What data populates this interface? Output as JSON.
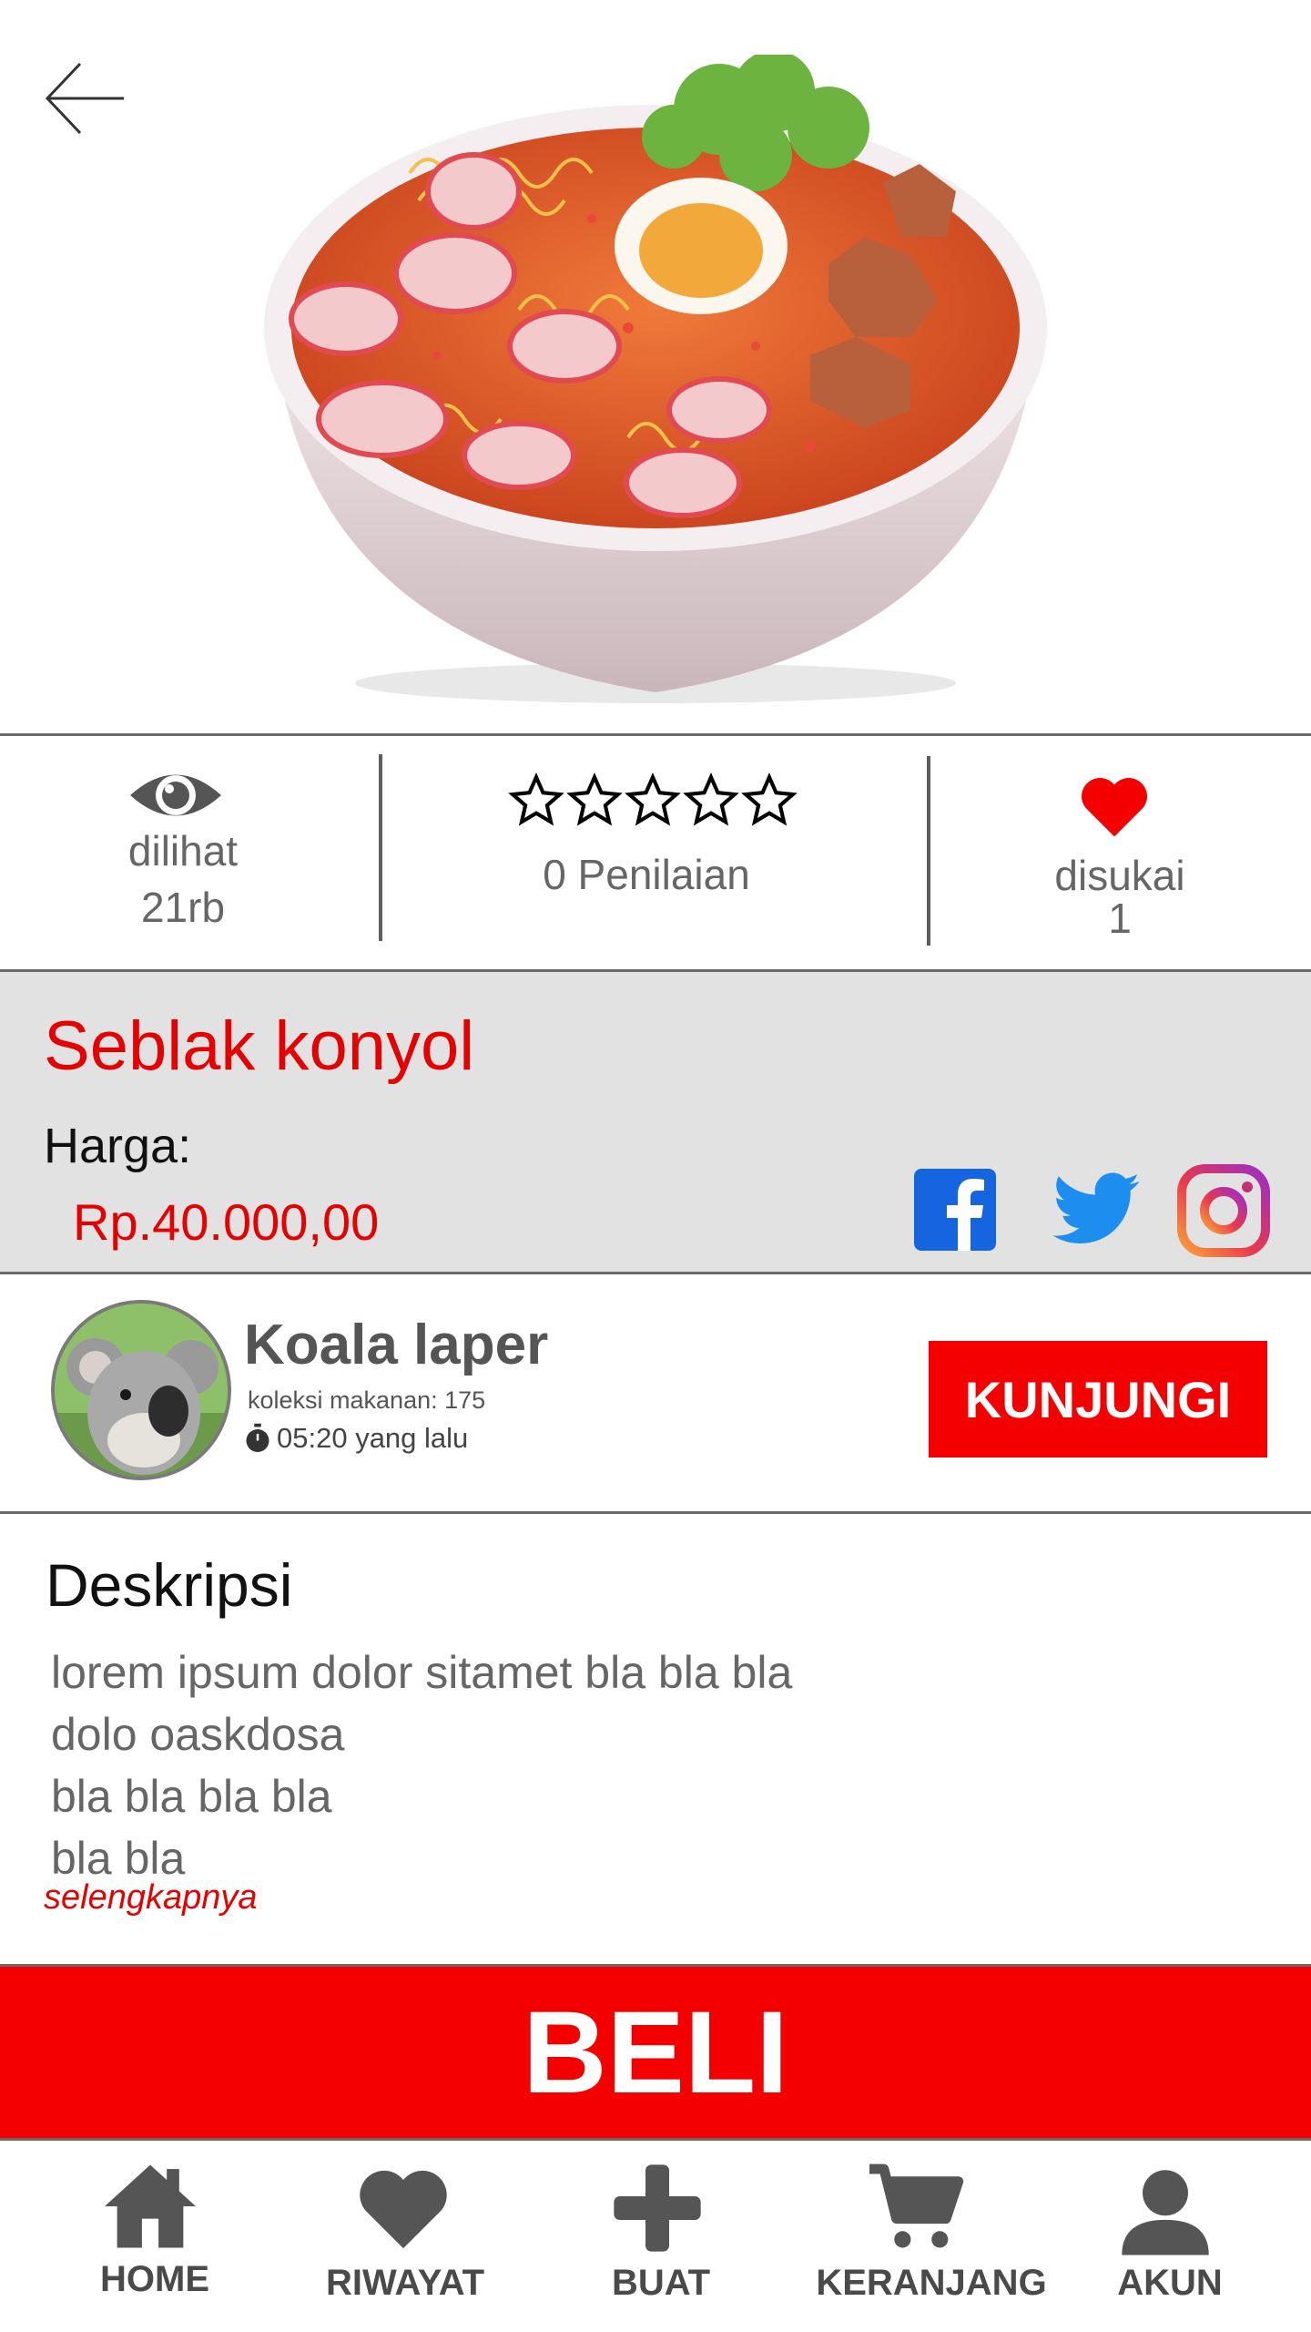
{
  "stats": {
    "views_label": "dilihat",
    "views_value": "21rb",
    "rating_label": "0 Penilaian",
    "rating_value": 0,
    "rating_max": 5,
    "likes_label": "disukai",
    "likes_value": "1"
  },
  "product": {
    "title": "Seblak konyol",
    "price_label": "Harga:",
    "price": "Rp.40.000,00"
  },
  "social": {
    "icons": [
      "facebook-icon",
      "twitter-icon",
      "instagram-icon"
    ]
  },
  "seller": {
    "name": "Koala laper",
    "collection": "koleksi makanan: 175",
    "time": "05:20 yang lalu",
    "visit_label": "KUNJUNGI"
  },
  "description": {
    "title": "Deskripsi",
    "lines": [
      "lorem ipsum dolor sitamet bla bla bla",
      "dolo oaskdosa",
      "bla bla bla bla",
      "bla bla"
    ],
    "more_label": "selengkapnya"
  },
  "buy_label": "BELI",
  "nav": {
    "home": "HOME",
    "history": "RIWAYAT",
    "create": "BUAT",
    "cart": "KERANJANG",
    "account": "AKUN"
  },
  "colors": {
    "accent": "#f50000",
    "info_bg": "#e2e2e2",
    "facebook": "#1565e0",
    "twitter": "#1d8ef0"
  }
}
